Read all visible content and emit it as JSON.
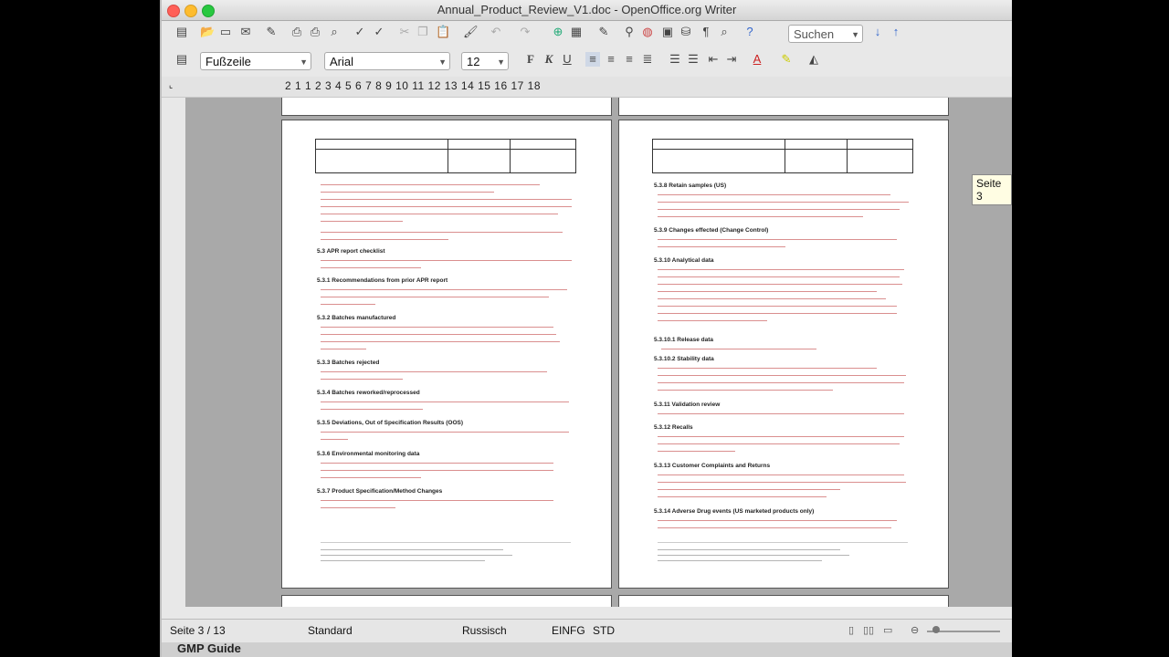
{
  "window": {
    "title": "Annual_Product_Review_V1.doc - OpenOffice.org Writer"
  },
  "toolbar": {
    "search_placeholder": "Suchen"
  },
  "format": {
    "style": "Fußzeile",
    "font": "Arial",
    "size": "12"
  },
  "ruler": {
    "numbers": "2  1     1  2  3  4  5  6  7  8  9 10 11 12 13 14 15 16 17 18"
  },
  "tooltip": "Seite 3",
  "status": {
    "page": "Seite 3 / 13",
    "style": "Standard",
    "language": "Russisch",
    "insert": "EINFG",
    "selection": "STD"
  },
  "dock": {
    "label": "GMP Guide"
  },
  "doc_left": {
    "headings": [
      "5.3 APR report checklist",
      "5.3.1 Recommendations from prior APR report",
      "5.3.2 Batches manufactured",
      "5.3.3 Batches rejected",
      "5.3.4 Batches reworked/reprocessed",
      "5.3.5 Deviations, Out of Specification Results (OOS)",
      "5.3.6 Environmental monitoring data",
      "5.3.7 Product Specification/Method Changes"
    ]
  },
  "doc_right": {
    "headings": [
      "5.3.8 Retain samples (US)",
      "5.3.9 Changes effected (Change Control)",
      "5.3.10 Analytical data",
      "5.3.10.1 Release data",
      "5.3.10.2 Stability data",
      "5.3.11 Validation review",
      "5.3.12 Recalls",
      "5.3.13 Customer Complaints and Returns",
      "5.3.14 Adverse Drug events (US marketed products only)"
    ]
  }
}
